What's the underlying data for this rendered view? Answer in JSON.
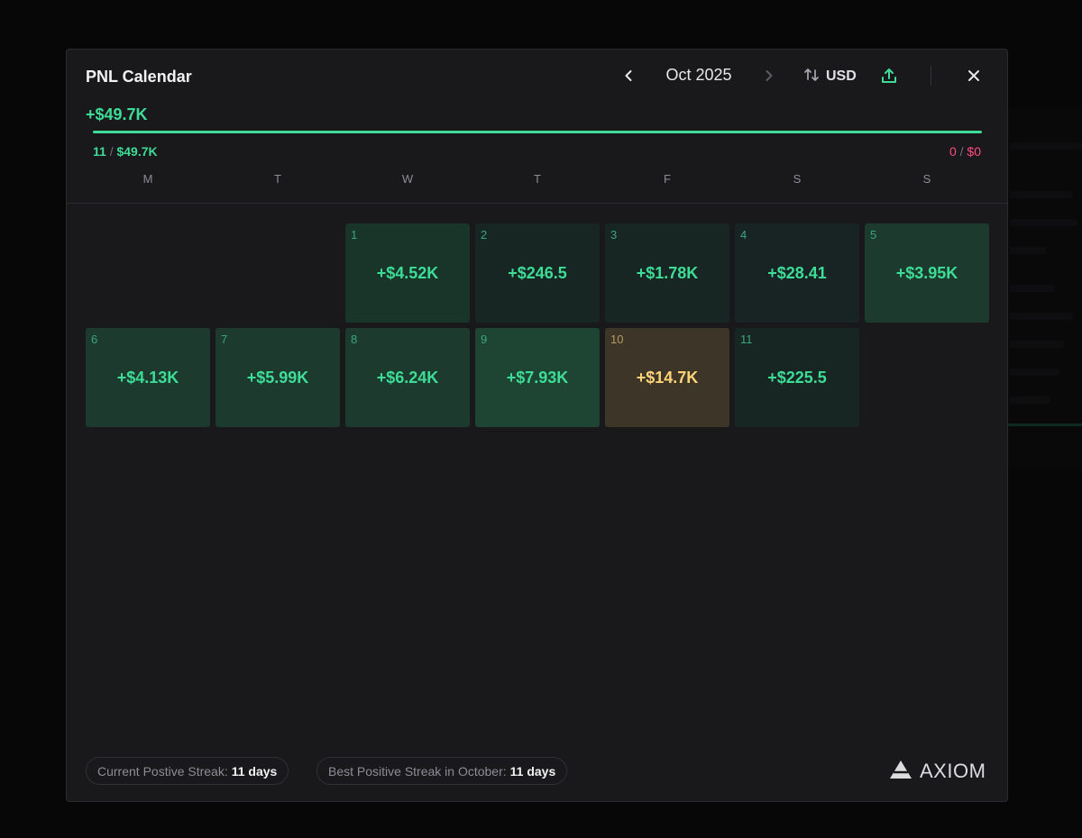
{
  "modal": {
    "title": "PNL Calendar",
    "month_label": "Oct 2025",
    "currency": "USD",
    "total": "+$49.7K",
    "positive_days": "11",
    "positive_total": "$49.7K",
    "negative_days": "0",
    "negative_total": "$0",
    "separator": "/"
  },
  "weekdays": [
    "M",
    "T",
    "W",
    "T",
    "F",
    "S",
    "S"
  ],
  "days": [
    {
      "day": "1",
      "value": "+$4.52K"
    },
    {
      "day": "2",
      "value": "+$246.5"
    },
    {
      "day": "3",
      "value": "+$1.78K"
    },
    {
      "day": "4",
      "value": "+$28.41"
    },
    {
      "day": "5",
      "value": "+$3.95K"
    },
    {
      "day": "6",
      "value": "+$4.13K"
    },
    {
      "day": "7",
      "value": "+$5.99K"
    },
    {
      "day": "8",
      "value": "+$6.24K"
    },
    {
      "day": "9",
      "value": "+$7.93K"
    },
    {
      "day": "10",
      "value": "+$14.7K"
    },
    {
      "day": "11",
      "value": "+$225.5"
    }
  ],
  "footer": {
    "current_streak_label": "Current Postive Streak:",
    "current_streak_value": "11 days",
    "best_streak_label": "Best Positive Streak in October:",
    "best_streak_value": "11 days",
    "logo_text": "AXIOM"
  },
  "colors": {
    "positive": "#3ddc97",
    "negative": "#ff4d7d",
    "best_day": "#ffd479",
    "modal_bg": "#19191b"
  },
  "icons": {
    "prev": "chevron-left-icon",
    "next": "chevron-right-icon",
    "currency": "swap-vertical-icon",
    "export": "upload-icon",
    "close": "close-icon",
    "logo": "axiom-logo-icon"
  }
}
